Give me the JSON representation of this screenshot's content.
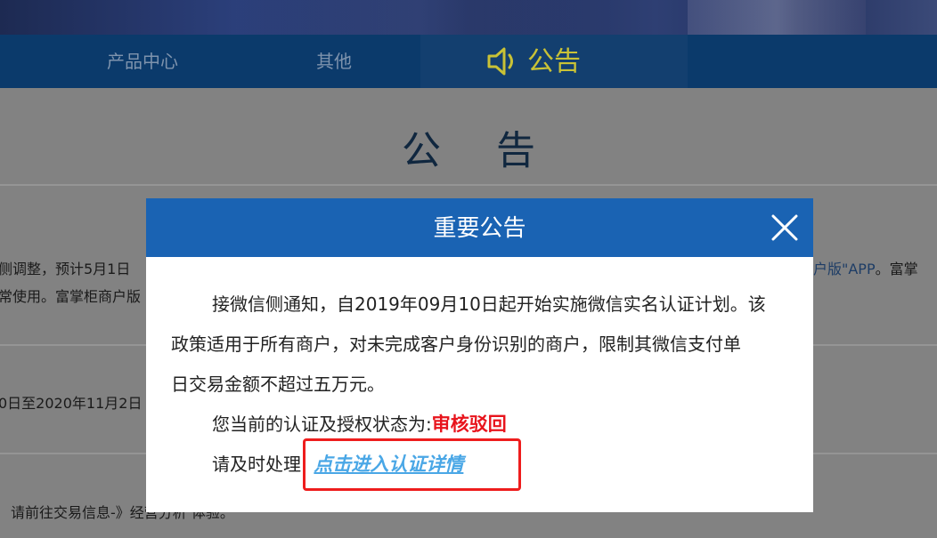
{
  "nav": {
    "items": [
      {
        "label": "产品中心"
      },
      {
        "label": "其他"
      }
    ],
    "active": {
      "label": "公告",
      "icon": "speaker-icon"
    }
  },
  "page": {
    "title": "公 告",
    "line1_left": "侧调整，预计5月1日",
    "line1_right": "户版\"APP",
    "line1_right_tail": "。富掌",
    "line2_left": "常使用。富掌柜商户版",
    "line3_left": "0日至2020年11月2日",
    "line4_left": "请前往交易信息-》经营分析 体验。"
  },
  "modal": {
    "title": "重要公告",
    "close_icon": "close-icon",
    "paragraph": {
      "line1": "接微信侧通知，自2019年09月10日起开始实施微信实名认证计划。该",
      "line2": "政策适用于所有商户，对未完成客户身份识别的商户，限制其微信支付单",
      "line3": "日交易金额不超过五万元。"
    },
    "status_label": "您当前的认证及授权状态为:",
    "status_value": "审核驳回",
    "action_prompt": "请及时处理!",
    "detail_link": "点击进入认证详情"
  },
  "colors": {
    "nav_bg": "#0b3a6b",
    "nav_active_text": "#c9c236",
    "modal_header": "#1a63b3",
    "status_red": "#e8141c",
    "link_blue": "#4aa7e6",
    "highlight_border": "#ee1d1d"
  }
}
